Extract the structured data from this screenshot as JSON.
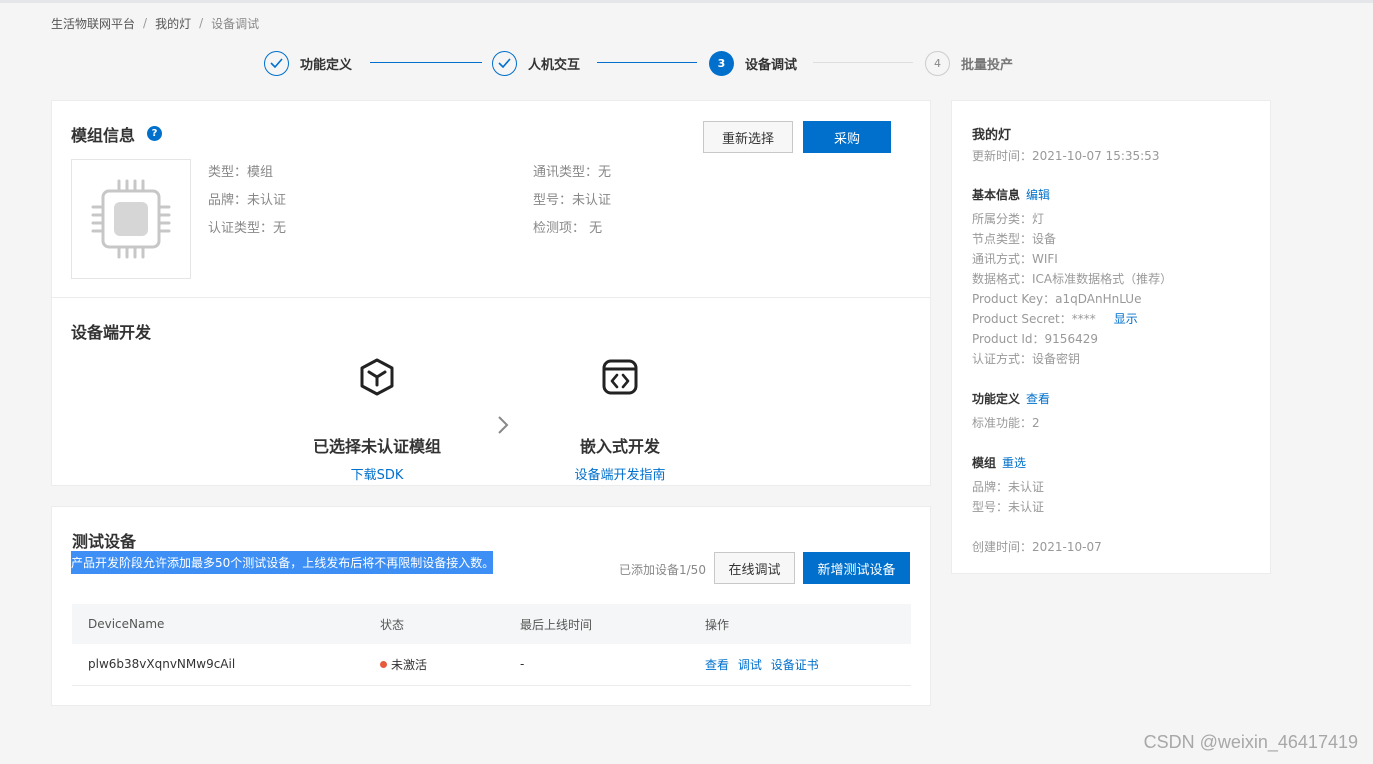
{
  "breadcrumb": [
    "生活物联网平台",
    "我的灯",
    "设备调试"
  ],
  "steps": [
    {
      "label": "功能定义",
      "state": "done"
    },
    {
      "label": "人机交互",
      "state": "done"
    },
    {
      "label": "设备调试",
      "state": "active",
      "num": "3"
    },
    {
      "label": "批量投产",
      "state": "todo",
      "num": "4"
    }
  ],
  "module": {
    "title": "模组信息",
    "help": "?",
    "reselect_label": "重新选择",
    "purchase_label": "采购",
    "fields": {
      "type": "类型：模组",
      "brand": "品牌：未认证",
      "cert_type": "认证类型：无",
      "comm_type": "通讯类型：无",
      "model": "型号：未认证",
      "check": "检测项： 无"
    }
  },
  "dev": {
    "title": "设备端开发",
    "left_title": "已选择未认证模组",
    "left_link": "下载SDK",
    "right_title": "嵌入式开发",
    "right_link": "设备端开发指南"
  },
  "test": {
    "title": "测试设备",
    "notice": "产品开发阶段允许添加最多50个测试设备，上线发布后将不再限制设备接入数。",
    "added": "已添加设备1/50",
    "online_debug_label": "在线调试",
    "add_label": "新增测试设备",
    "columns": [
      "DeviceName",
      "状态",
      "最后上线时间",
      "操作"
    ],
    "rows": [
      {
        "name": "plw6b38vXqnvNMw9cAil",
        "status": "未激活",
        "last": "-",
        "ops": [
          "查看",
          "调试",
          "设备证书"
        ]
      }
    ]
  },
  "panel": {
    "name": "我的灯",
    "updated": "更新时间：2021-10-07 15:35:53",
    "basic_title": "基本信息",
    "basic_edit": "编辑",
    "category": "所属分类：灯",
    "node_type": "节点类型：设备",
    "comm": "通讯方式：WIFI",
    "format": "数据格式：ICA标准数据格式（推荐）",
    "product_key": "Product Key：a1qDAnHnLUe",
    "product_secret": "Product Secret：****",
    "show": "显示",
    "product_id": "Product Id：9156429",
    "auth": "认证方式：设备密钥",
    "func_title": "功能定义",
    "func_view": "查看",
    "std_func": "标准功能：2",
    "module_title": "模组",
    "module_reselect": "重选",
    "module_brand": "品牌：未认证",
    "module_model": "型号：未认证",
    "created": "创建时间：2021-10-07"
  },
  "watermark": "CSDN @weixin_46417419",
  "colors": {
    "primary": "#0070cc",
    "notice_bg": "#3d8ff5",
    "inactive_dot": "#e55b3c"
  }
}
